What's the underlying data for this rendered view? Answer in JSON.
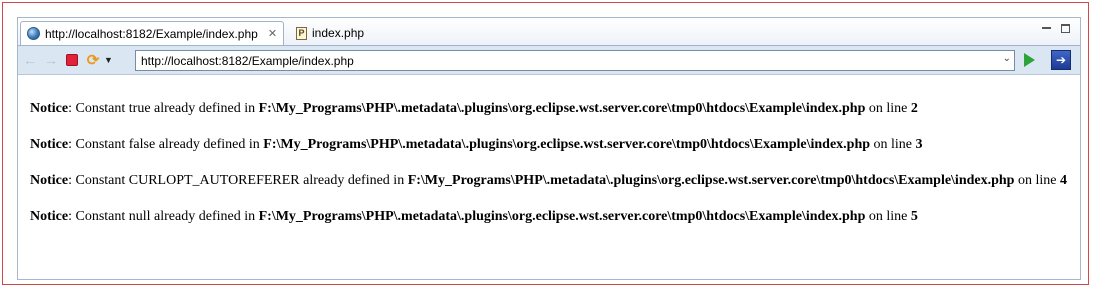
{
  "tabs": [
    {
      "label": "http://localhost:8182/Example/index.php",
      "active": true,
      "icon": "globe-icon"
    },
    {
      "label": "index.php",
      "active": false,
      "icon": "php-file-icon"
    }
  ],
  "tab_close_glyph": "✕",
  "window": {
    "minimize": "minimize-icon",
    "maximize": "maximize-icon"
  },
  "toolbar": {
    "back": "←",
    "forward": "→",
    "refresh": "⟳",
    "dropdown": "▼",
    "url": "http://localhost:8182/Example/index.php",
    "url_chevron": "⌄",
    "ext": "➔"
  },
  "notices": [
    {
      "label": "Notice",
      "text": ": Constant true already defined in ",
      "path": "F:\\My_Programs\\PHP\\.metadata\\.plugins\\org.eclipse.wst.server.core\\tmp0\\htdocs\\Example\\index.php",
      "line_text": " on line ",
      "line": "2"
    },
    {
      "label": "Notice",
      "text": ": Constant false already defined in ",
      "path": "F:\\My_Programs\\PHP\\.metadata\\.plugins\\org.eclipse.wst.server.core\\tmp0\\htdocs\\Example\\index.php",
      "line_text": " on line ",
      "line": "3"
    },
    {
      "label": "Notice",
      "text": ": Constant CURLOPT_AUTOREFERER already defined in ",
      "path": "F:\\My_Programs\\PHP\\.metadata\\.plugins\\org.eclipse.wst.server.core\\tmp0\\htdocs\\Example\\index.php",
      "line_text": " on line ",
      "line": "4"
    },
    {
      "label": "Notice",
      "text": ": Constant null already defined in ",
      "path": "F:\\My_Programs\\PHP\\.metadata\\.plugins\\org.eclipse.wst.server.core\\tmp0\\htdocs\\Example\\index.php",
      "line_text": " on line ",
      "line": "5"
    }
  ],
  "colors": {
    "frame": "#d44848",
    "toolbar": "#dbe6f3",
    "go": "#2ea33a",
    "stop": "#e0223a"
  }
}
